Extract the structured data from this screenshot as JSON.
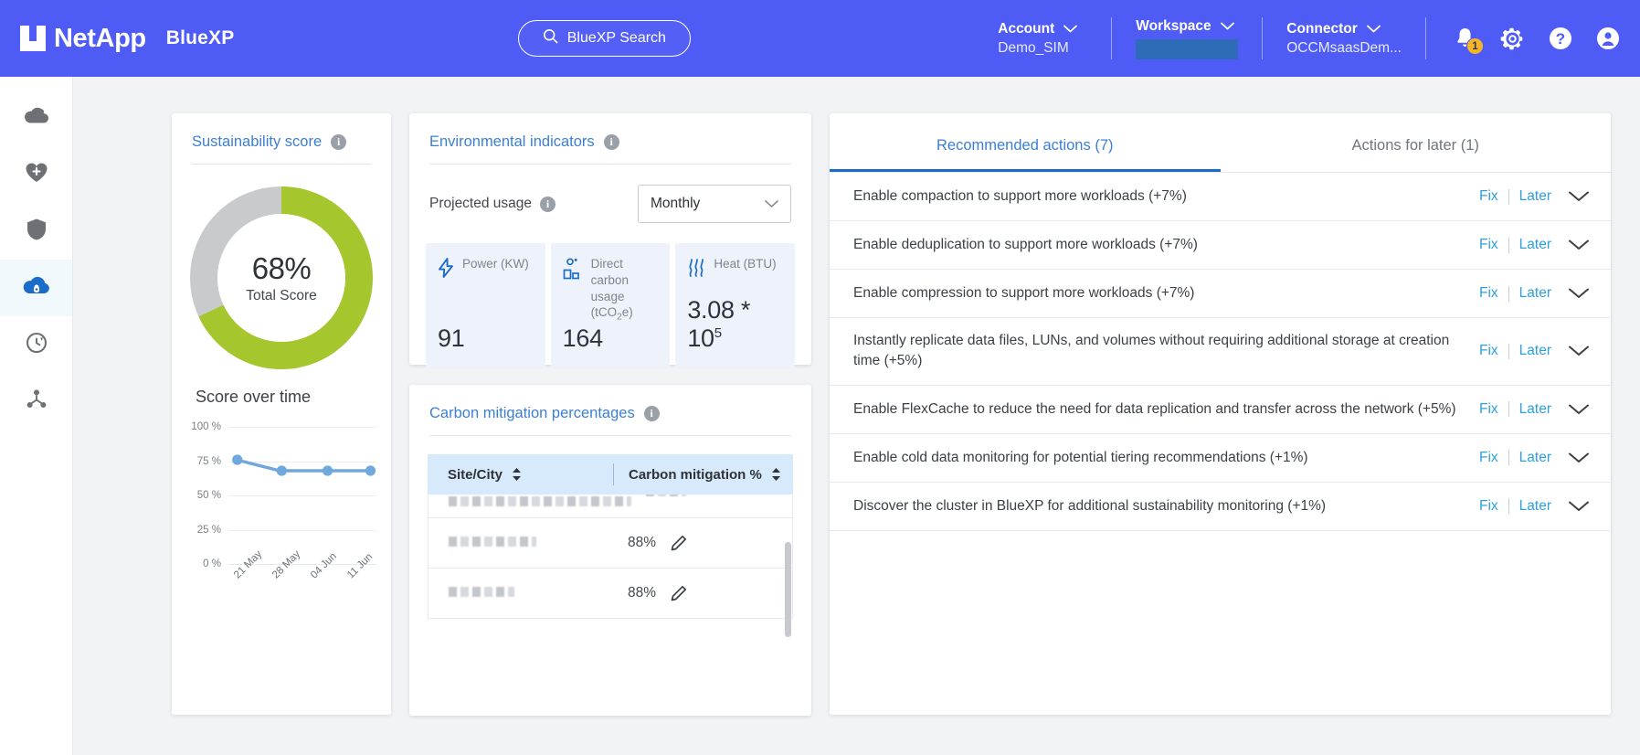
{
  "header": {
    "brand_name": "NetApp",
    "product_name": "BlueXP",
    "search_label": "BlueXP Search",
    "search_icon": "search-icon",
    "account": {
      "label": "Account",
      "value": "Demo_SIM"
    },
    "workspace": {
      "label": "Workspace",
      "value": ""
    },
    "connector": {
      "label": "Connector",
      "value": "OCCMsaasDem..."
    },
    "notification_count": "1",
    "icons": [
      "bell-icon",
      "gear-icon",
      "help-icon",
      "user-avatar-icon"
    ],
    "brand_color": "#4f5bf5"
  },
  "sidebar": {
    "items": [
      {
        "name": "storage-icon",
        "active": false
      },
      {
        "name": "health-icon",
        "active": false
      },
      {
        "name": "protection-shield-icon",
        "active": false
      },
      {
        "name": "sustainability-cloud-icon",
        "active": true
      },
      {
        "name": "mobility-sync-icon",
        "active": false
      },
      {
        "name": "governance-share-icon",
        "active": false
      }
    ],
    "active_color": "#1a6cc9"
  },
  "sustainability_card": {
    "title": "Sustainability score",
    "info_icon": "info-icon",
    "score_value": "68%",
    "score_label": "Total Score",
    "chart_heading": "Score over time"
  },
  "environmental_card": {
    "title": "Environmental indicators",
    "info_icon": "info-icon",
    "projected_usage_label": "Projected usage",
    "period_selected": "Monthly",
    "kpis": [
      {
        "icon": "power-bolt-icon",
        "label": "Power (KW)",
        "value": "91"
      },
      {
        "icon": "carbon-cloud-icon",
        "label_line1": "Direct carbon",
        "label_line2": "usage (tCO",
        "label_sub": "2",
        "label_line3": "e)",
        "value": "164"
      },
      {
        "icon": "heat-waves-icon",
        "label": "Heat (BTU)",
        "value_base": "3.08 * 10",
        "value_exp": "5"
      }
    ]
  },
  "carbon_card": {
    "title": "Carbon mitigation percentages",
    "info_icon": "info-icon",
    "columns": [
      "Site/City",
      "Carbon mitigation %"
    ],
    "rows": [
      {
        "site": "",
        "pct": "",
        "redacted": true,
        "clipped": true
      },
      {
        "site": "",
        "pct": "88%",
        "redacted": true,
        "clipped": false
      },
      {
        "site": "",
        "pct": "88%",
        "redacted": true,
        "clipped": false
      }
    ],
    "edit_icon": "pencil-edit-icon",
    "sort_icon": "sort-arrows-icon"
  },
  "actions_card": {
    "tabs": [
      {
        "label": "Recommended actions (7)",
        "active": true
      },
      {
        "label": "Actions for later (1)",
        "active": false
      }
    ],
    "fix_label": "Fix",
    "later_label": "Later",
    "expand_icon": "chevron-down-icon",
    "rows": [
      {
        "text": "Enable compaction to support more workloads (+7%)"
      },
      {
        "text": "Enable deduplication to support more workloads (+7%)"
      },
      {
        "text": "Enable compression to support more workloads (+7%)"
      },
      {
        "text": "Instantly replicate data files, LUNs, and volumes without requiring additional storage at creation time (+5%)"
      },
      {
        "text": "Enable FlexCache to reduce the need for data replication and transfer across the network (+5%)"
      },
      {
        "text": "Enable cold data monitoring for potential tiering recommendations (+1%)"
      },
      {
        "text": "Discover the cluster in BlueXP for additional sustainability monitoring (+1%)"
      }
    ]
  },
  "chart_data": [
    {
      "type": "pie",
      "title": "Sustainability score",
      "labels": [
        "Total Score",
        "Remaining"
      ],
      "values": [
        68,
        32
      ],
      "colors": [
        "#a5c62c",
        "#c8cacc"
      ],
      "center_label": "68%",
      "center_sublabel": "Total Score",
      "legend": "none"
    },
    {
      "type": "line",
      "title": "Score over time",
      "x": [
        "21 May",
        "28 May",
        "04 Jun",
        "11 Jun"
      ],
      "values": [
        76,
        68,
        68,
        68
      ],
      "ytick_labels": [
        "100 %",
        "75 %",
        "50 %",
        "25 %",
        "0 %"
      ],
      "ytick_values": [
        100,
        75,
        50,
        25,
        0
      ],
      "ylim": [
        0,
        100
      ],
      "xlabel": "",
      "ylabel": "",
      "series_color": "#6fa8dc",
      "grid": true,
      "legend": "none"
    }
  ]
}
